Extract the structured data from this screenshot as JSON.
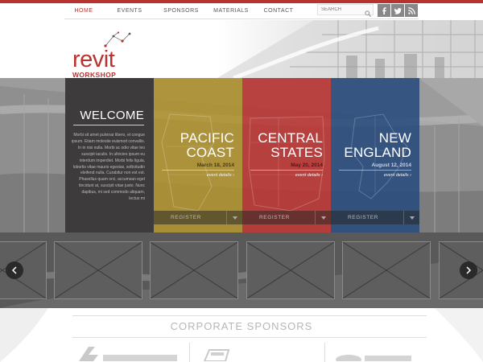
{
  "nav": {
    "items": [
      {
        "label": "HOME",
        "active": true
      },
      {
        "label": "EVENTS"
      },
      {
        "label": "SPONSORS"
      },
      {
        "label": "MATERIALS"
      },
      {
        "label": "CONTACT"
      }
    ],
    "search_placeholder": "SEARCH"
  },
  "social": [
    {
      "icon": "facebook-icon"
    },
    {
      "icon": "twitter-icon"
    },
    {
      "icon": "rss-icon"
    }
  ],
  "logo": {
    "word": "revit",
    "sub": "WORKSHOP"
  },
  "welcome": {
    "title": "WELCOME",
    "body": "Morbi sit amet pulvinar libero, et congue ipsum. Etiam molestie euismod convallis. In in nisi nulla. Morbi ac odio vitae leo suscipit iaculis. In ultricies ipsum eu interdum imperdiet. Morbi felis ligula, lobortis vitae mauris egestas, sollicitudin eleifend nulla. Curabitur non est est. Phasellus quam orci, accumsan eget tincidunt at, suscipit vitae justo. Nunc dapibus, mi sed commodo aliquam, lectus mi"
  },
  "regions": [
    {
      "line1": "PACIFIC",
      "line2": "COAST",
      "date": "March 18, 2014",
      "details": "event details",
      "register": "REGISTER"
    },
    {
      "line1": "CENTRAL",
      "line2": "STATES",
      "date": "May 20, 2014",
      "details": "event details",
      "register": "REGISTER"
    },
    {
      "line1": "NEW",
      "line2": "ENGLAND",
      "date": "August 12, 2014",
      "details": "event details",
      "register": "REGISTER"
    }
  ],
  "sponsors": {
    "title": "CORPORATE SPONSORS"
  },
  "colors": {
    "brand_red": "#b8322f",
    "pacific": "#b29428",
    "central": "#bd3330",
    "new_england": "#284b7d",
    "welcome": "#3d3b3b"
  }
}
